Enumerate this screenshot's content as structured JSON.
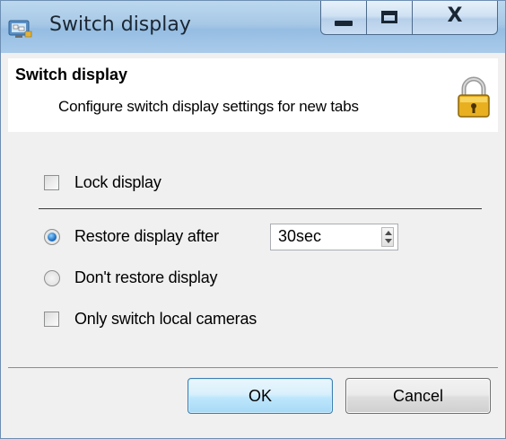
{
  "window": {
    "title": "Switch display",
    "minimize_icon": "minimize-icon",
    "maximize_icon": "maximize-icon",
    "close_glyph": "X"
  },
  "header": {
    "title": "Switch display",
    "subtitle": "Configure switch display settings for new tabs",
    "icon": "padlock-icon"
  },
  "options": {
    "lock_display": {
      "label": "Lock display",
      "checked": false
    },
    "restore_after": {
      "label": "Restore display after",
      "selected": true,
      "value": "30sec"
    },
    "dont_restore": {
      "label": "Don't restore display",
      "selected": false
    },
    "only_local": {
      "label": "Only switch local cameras",
      "checked": false
    }
  },
  "buttons": {
    "ok": "OK",
    "cancel": "Cancel"
  },
  "colors": {
    "accent": "#1f6fc2",
    "titlebar": "#a7c8e6"
  }
}
